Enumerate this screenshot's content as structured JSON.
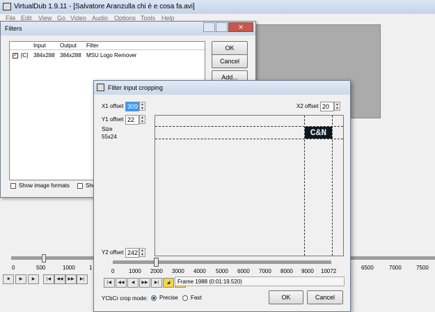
{
  "main": {
    "title": "VirtualDub 1.9.11 - [Salvatore Aranzulla chi è e cosa fa.avi]",
    "menu": [
      "File",
      "Edit",
      "View",
      "Go",
      "Video",
      "Audio",
      "Options",
      "Tools",
      "Help"
    ],
    "timeline_ticks": [
      "0",
      "500",
      "1000",
      "1",
      "6500",
      "7000",
      "7500"
    ]
  },
  "filters": {
    "title": "Filters",
    "columns": [
      "Input",
      "Output",
      "Filter"
    ],
    "row": {
      "flag": "[C]",
      "input": "384x288",
      "output": "384x288",
      "filter": "MSU Logo Remover"
    },
    "ok": "OK",
    "cancel": "Cancel",
    "add": "Add...",
    "show_formats": "Show image formats",
    "show_partial": "Sho"
  },
  "crop": {
    "title": "Filter input cropping",
    "x1_label": "X1 offset",
    "x1_value": "309",
    "y1_label": "Y1 offset",
    "y1_value": "22",
    "x2_label": "X2 offset",
    "x2_value": "20",
    "y2_label": "Y2 offset",
    "y2_value": "242",
    "size_label": "Size",
    "size_value": "55x24",
    "logo_text": "C&N",
    "ticks": [
      "0",
      "1000",
      "2000",
      "3000",
      "4000",
      "5000",
      "6000",
      "7000",
      "8000",
      "9000",
      "10072"
    ],
    "frame_text": "Frame 1988 (0:01:19.520)",
    "crop_mode_label": "YCbCr crop mode:",
    "precise": "Precise",
    "fast": "Fast",
    "ok": "OK",
    "cancel": "Cancel"
  }
}
